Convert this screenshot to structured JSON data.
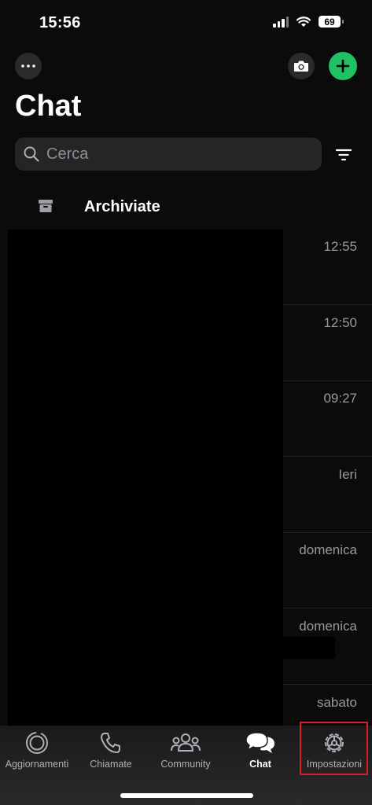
{
  "status_bar": {
    "time": "15:56",
    "battery": "69"
  },
  "header": {
    "title": "Chat"
  },
  "search": {
    "placeholder": "Cerca"
  },
  "archived": {
    "label": "Archiviate"
  },
  "chats": [
    {
      "time": "12:55"
    },
    {
      "time": "12:50"
    },
    {
      "time": "09:27"
    },
    {
      "time": "Ieri"
    },
    {
      "time": "domenica"
    },
    {
      "time": "domenica"
    },
    {
      "time": "sabato"
    }
  ],
  "tabs": [
    {
      "label": "Aggiornamenti",
      "icon": "updates-icon"
    },
    {
      "label": "Chiamate",
      "icon": "phone-icon"
    },
    {
      "label": "Community",
      "icon": "community-icon"
    },
    {
      "label": "Chat",
      "icon": "chat-bubbles-icon",
      "active": true
    },
    {
      "label": "Impostazioni",
      "icon": "settings-gear-icon"
    }
  ],
  "colors": {
    "accent": "#21c063",
    "background": "#0b0b0b",
    "highlight": "#d81f26"
  }
}
